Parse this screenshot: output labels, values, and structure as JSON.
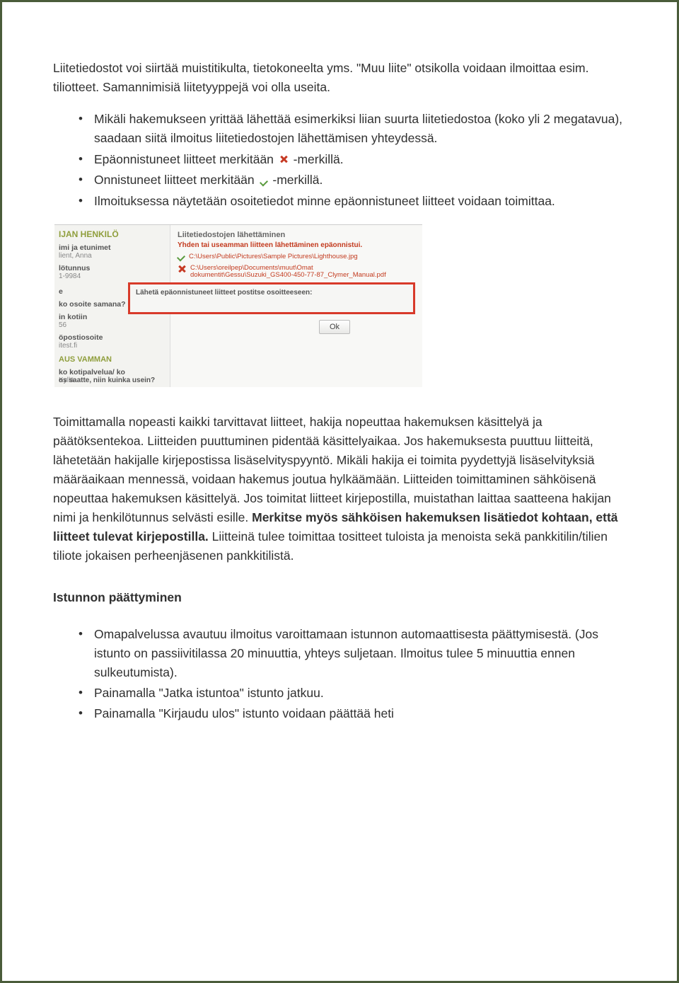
{
  "intro": "Liitetiedostot voi siirtää muistitikulta, tietokoneelta yms. \"Muu liite\" otsikolla voidaan ilmoittaa esim. tiliotteet. Samannimisiä liitetyyppejä voi olla useita.",
  "list1": {
    "a": "Mikäli hakemukseen yrittää lähettää esimerkiksi liian suurta liitetiedostoa (koko yli 2 megatavua), saadaan siitä ilmoitus liitetiedostojen lähettämisen yhteydessä.",
    "b_pre": "Epäonnistuneet liitteet merkitään ",
    "b_post": " -merkillä.",
    "c_pre": "Onnistuneet liitteet merkitään ",
    "c_post": " -merkillä.",
    "d": "Ilmoituksessa näytetään osoitetiedot minne epäonnistuneet liitteet voidaan toimittaa."
  },
  "shot": {
    "left": {
      "header": "IJAN HENKILÖ",
      "name_lbl": "imi ja etunimet",
      "name_val": "lient, Anna",
      "id_lbl": "lötunnus",
      "id_val": "1-9984",
      "addr_lbl": "ko osoite samana? C",
      "home_lbl": "in kotiin",
      "home_val": "56",
      "mail_lbl": "öpostiosoite",
      "mail_val": "itest.fi",
      "sect": "AUS VAMMAN",
      "svc_lbl": "ko kotipalvelua/ ko",
      "svc_val": "Kyllä",
      "freq": "os saatte, niin kuinka usein?"
    },
    "right": {
      "title": "Liitetiedostojen lähettäminen",
      "err": "Yhden tai useamman liitteen lähettäminen epäonnistui.",
      "file1": "C:\\Users\\Public\\Pictures\\Sample Pictures\\Lighthouse.jpg",
      "file2": "C:\\Users\\oreilpep\\Documents\\muut\\Omat dokumentit\\Gessu\\Suzuki_GS400-450-77-87_Clymer_Manual.pdf",
      "sendlabel": "Lähetä epäonnistuneet liitteet postitse osoitteeseen:",
      "ok": "Ok"
    }
  },
  "para2": {
    "t1": "Toimittamalla nopeasti kaikki tarvittavat liitteet, hakija nopeuttaa hakemuksen käsittelyä ja päätöksentekoa. Liitteiden puuttuminen pidentää käsittelyaikaa. Jos hakemuksesta puuttuu liitteitä, lähetetään hakijalle kirjepostissa lisäselvityspyyntö. Mikäli hakija ei toimita pyydettyjä lisäselvityksiä määräaikaan mennessä, voidaan hakemus joutua hylkäämään. Liitteiden toimittaminen sähköisenä nopeuttaa hakemuksen käsittelyä. Jos toimitat liitteet kirjepostilla, muistathan laittaa saatteena hakijan nimi ja henkilötunnus selvästi esille. ",
    "t2": "Merkitse myös sähköisen hakemuksen lisätiedot kohtaan, että liitteet tulevat kirjepostilla.",
    "t3": " Liitteinä tulee toimittaa tositteet tuloista ja menoista sekä pankkitilin/tilien tiliote jokaisen perheenjäsenen pankkitilistä."
  },
  "subhead": "Istunnon päättyminen",
  "list2": {
    "a": "Omapalvelussa avautuu ilmoitus varoittamaan istunnon automaattisesta päättymisestä. (Jos istunto on passiivitilassa 20 minuuttia, yhteys suljetaan. Ilmoitus tulee 5 minuuttia ennen sulkeutumista).",
    "b": "Painamalla \"Jatka istuntoa\" istunto jatkuu.",
    "c": "Painamalla \"Kirjaudu ulos\" istunto voidaan päättää heti"
  }
}
